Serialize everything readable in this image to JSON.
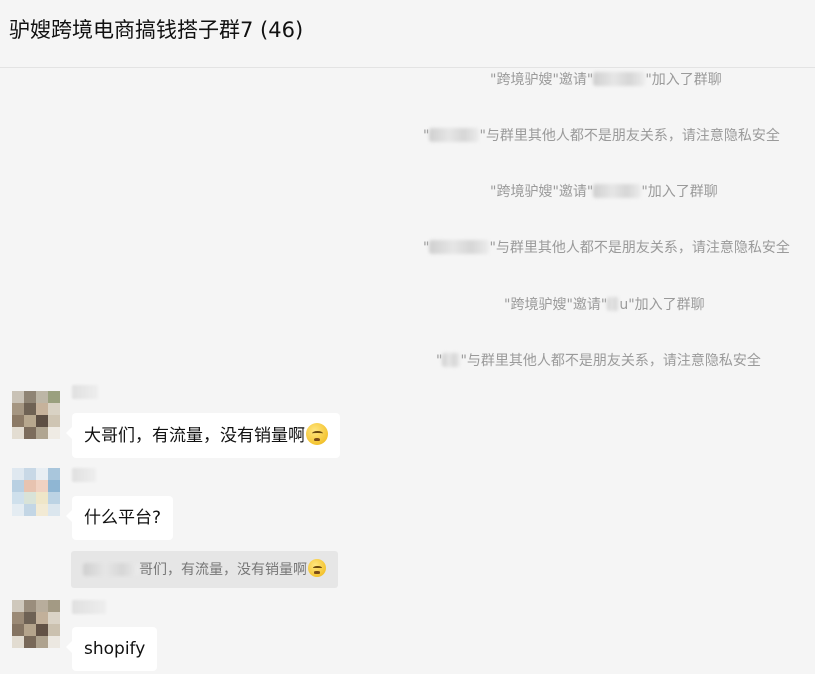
{
  "header": {
    "title": "驴嫂跨境电商搞钱搭子群7 (46)"
  },
  "system_messages": [
    {
      "prefix": "\"跨境驴嫂\"邀请\"",
      "suffix": "\"加入了群聊"
    },
    {
      "prefix": "\"",
      "suffix": "\"与群里其他人都不是朋友关系，请注意隐私安全"
    },
    {
      "prefix": "\"跨境驴嫂\"邀请\"",
      "suffix": "\"加入了群聊"
    },
    {
      "prefix": "\"",
      "suffix": "\"与群里其他人都不是朋友关系，请注意隐私安全"
    },
    {
      "prefix": "\"跨境驴嫂\"邀请\"",
      "suffix": "u\"加入了群聊"
    },
    {
      "prefix": "\"",
      "suffix": "\"与群里其他人都不是朋友关系，请注意隐私安全"
    }
  ],
  "messages": [
    {
      "text": "大哥们，有流量，没有销量啊",
      "emoji": "crying-face-icon"
    },
    {
      "text": "什么平台?",
      "quote": "哥们，有流量，没有销量啊",
      "quote_emoji": "crying-face-icon"
    },
    {
      "text": "shopify"
    }
  ],
  "colors": {
    "background": "#f5f5f5",
    "bubble": "#ffffff",
    "system_text": "#9a9a9a",
    "quote_background": "#e6e6e6"
  }
}
